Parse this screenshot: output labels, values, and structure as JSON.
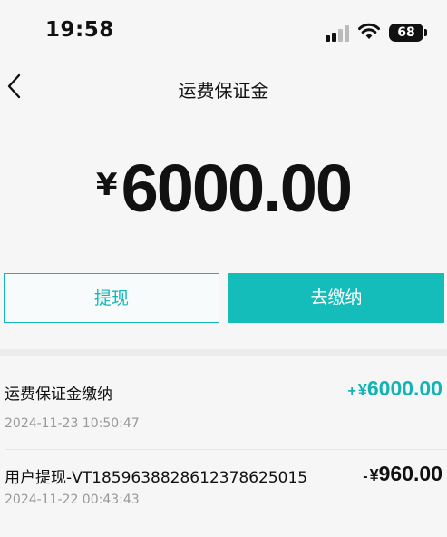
{
  "status_bar": {
    "time": "19:58",
    "battery": "68"
  },
  "header": {
    "title": "运费保证金"
  },
  "balance": {
    "currency": "¥",
    "amount": "6000.00"
  },
  "actions": {
    "withdraw_label": "提现",
    "pay_label": "去缴纳"
  },
  "records": [
    {
      "title": "运费保证金缴纳",
      "time": "2024-11-23 10:50:47",
      "sign": "+",
      "currency": "¥",
      "amount": "6000.00",
      "type": "credit"
    },
    {
      "title": "用户提现-VT1859638828612378625015",
      "time": "2024-11-22 00:43:43",
      "sign": "-",
      "currency": "¥",
      "amount": "960.00",
      "type": "debit"
    }
  ],
  "colors": {
    "accent": "#14bcba",
    "background": "#f6f6f7"
  }
}
